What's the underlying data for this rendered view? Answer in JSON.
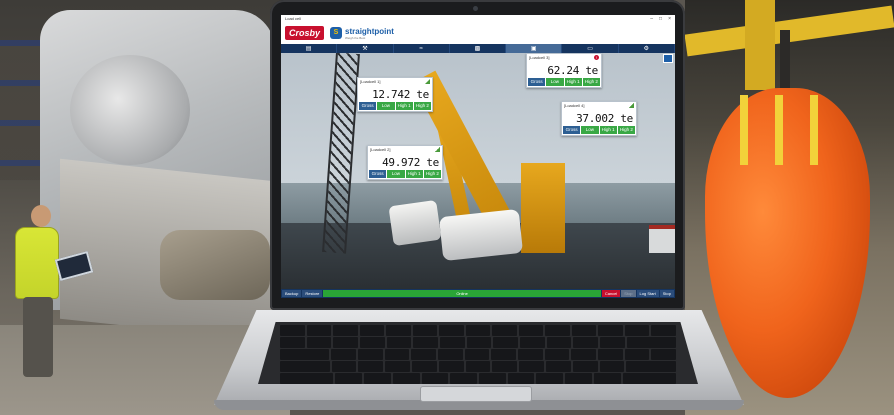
{
  "app": {
    "window_title": "Load cell",
    "brand": {
      "crosby": "Crosby",
      "straightpoint": "straightpoint",
      "tagline": "Weigh the Best"
    }
  },
  "toolbar": {
    "icons": [
      "list-icon",
      "wrench-icon",
      "wifi-icon",
      "bar-chart-icon",
      "image-icon",
      "monitor-icon",
      "settings-icon"
    ],
    "active_index": 4
  },
  "loadcells": [
    {
      "name": "[Loadcell 1]",
      "value": "12.742 te",
      "buttons": [
        "Gross",
        "Low",
        "High 1",
        "High 2"
      ],
      "alert": false
    },
    {
      "name": "[Loadcell 2]",
      "value": "49.972 te",
      "buttons": [
        "Gross",
        "Low",
        "High 1",
        "High 2"
      ],
      "alert": false
    },
    {
      "name": "[Loadcell 3]",
      "value": "62.24 te",
      "buttons": [
        "Gross",
        "Low",
        "High 1",
        "High 2"
      ],
      "alert": true
    },
    {
      "name": "[Loadcell 4]",
      "value": "37.002 te",
      "buttons": [
        "Gross",
        "Low",
        "High 1",
        "High 2"
      ],
      "alert": false
    }
  ],
  "bottombar": {
    "backup": "Backup",
    "restore": "Restore",
    "status": "Online",
    "cancel": "Cancel",
    "stop": "Stop",
    "log_start": "Log Start",
    "log_stop": "Stop"
  },
  "colors": {
    "toolbar": "#15345f",
    "status_ok": "#2aa536",
    "alarm": "#c8102e",
    "gross_button": "#2d5f93"
  }
}
